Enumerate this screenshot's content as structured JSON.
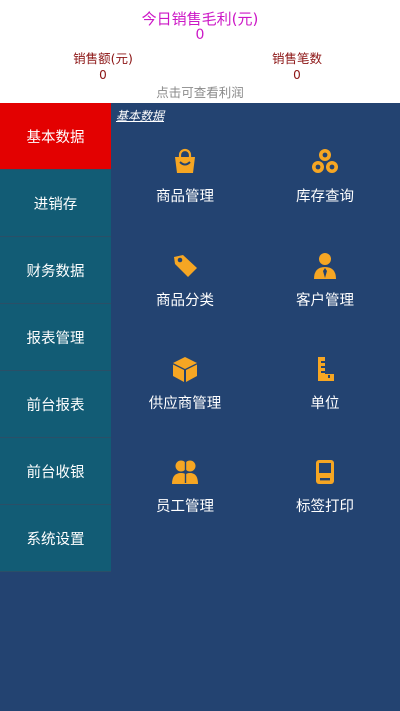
{
  "header": {
    "gross_profit_title": "今日销售毛利(元)",
    "gross_profit_value": "0",
    "sales_amount_label": "销售额(元)",
    "sales_amount_value": "0",
    "sales_count_label": "销售笔数",
    "sales_count_value": "0",
    "hint": "点击可查看利润"
  },
  "sidebar": {
    "items": [
      {
        "label": "基本数据",
        "active": true
      },
      {
        "label": "进销存"
      },
      {
        "label": "财务数据"
      },
      {
        "label": "报表管理"
      },
      {
        "label": "前台报表"
      },
      {
        "label": "前台收银"
      },
      {
        "label": "系统设置"
      }
    ]
  },
  "content": {
    "section_title": "基本数据",
    "tiles": [
      {
        "label": "商品管理",
        "icon": "shopping-bag-icon"
      },
      {
        "label": "库存查询",
        "icon": "stack-circles-icon"
      },
      {
        "label": "商品分类",
        "icon": "tag-icon"
      },
      {
        "label": "客户管理",
        "icon": "user-tie-icon"
      },
      {
        "label": "供应商管理",
        "icon": "box-icon"
      },
      {
        "label": "单位",
        "icon": "ruler-icon"
      },
      {
        "label": "员工管理",
        "icon": "users-icon"
      },
      {
        "label": "标签打印",
        "icon": "printer-icon"
      }
    ]
  },
  "colors": {
    "accent_pink": "#cc17c6",
    "stat_text": "#8b1313",
    "sidebar_bg": "#125c75",
    "sidebar_active": "#e30101",
    "content_bg": "#234371",
    "icon_orange": "#f6a623"
  }
}
